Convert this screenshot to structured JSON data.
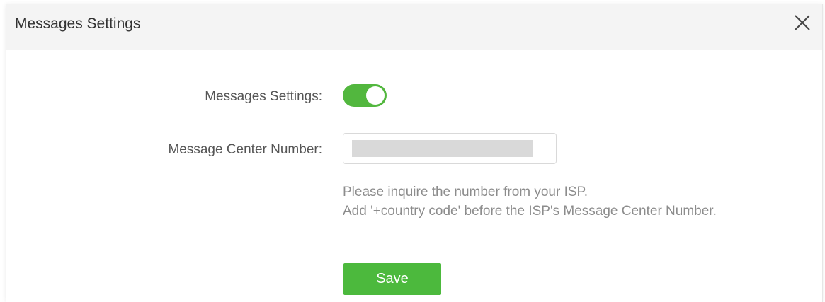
{
  "dialog": {
    "title": "Messages Settings"
  },
  "form": {
    "messages_label": "Messages Settings:",
    "messages_enabled": true,
    "center_number_label": "Message Center Number:",
    "center_number_value": "",
    "hint_line1": "Please inquire the number from your ISP.",
    "hint_line2": "Add '+country code' before the ISP's Message Center Number.",
    "save_label": "Save"
  },
  "colors": {
    "accent": "#52b73e",
    "button": "#4cb93d",
    "header_bg": "#f4f4f4",
    "label_text": "#555555",
    "hint_text": "#8c8c8c"
  },
  "icons": {
    "close": "close-icon"
  }
}
